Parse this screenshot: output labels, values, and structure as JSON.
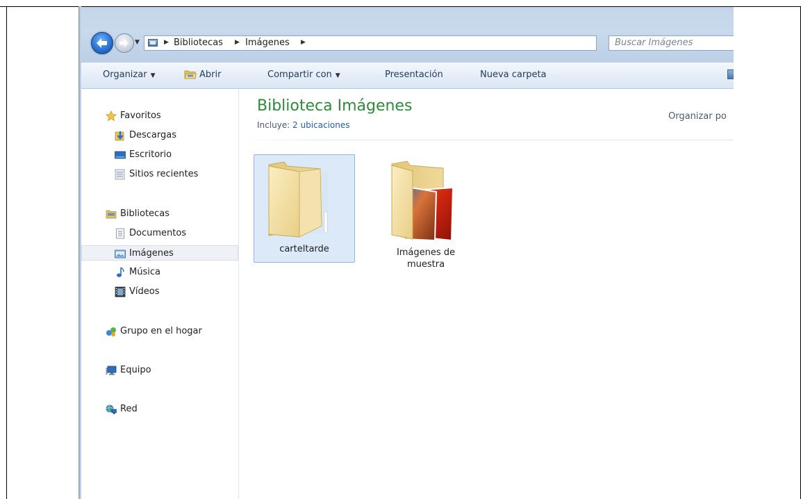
{
  "address_bar": {
    "crumbs": [
      "Bibliotecas",
      "Imágenes"
    ]
  },
  "search": {
    "placeholder": "Buscar Imágenes"
  },
  "toolbar": {
    "organize": "Organizar",
    "open": "Abrir",
    "share": "Compartir con",
    "slideshow": "Presentación",
    "new_folder": "Nueva carpeta"
  },
  "sidebar": {
    "favorites": {
      "label": "Favoritos",
      "items": [
        {
          "label": "Descargas",
          "icon": "downloads-icon"
        },
        {
          "label": "Escritorio",
          "icon": "desktop-icon"
        },
        {
          "label": "Sitios recientes",
          "icon": "recent-places-icon"
        }
      ]
    },
    "libraries": {
      "label": "Bibliotecas",
      "items": [
        {
          "label": "Documentos",
          "icon": "documents-icon"
        },
        {
          "label": "Imágenes",
          "icon": "pictures-icon",
          "selected": true
        },
        {
          "label": "Música",
          "icon": "music-icon"
        },
        {
          "label": "Vídeos",
          "icon": "videos-icon"
        }
      ]
    },
    "homegroup": "Grupo en el hogar",
    "computer": "Equipo",
    "network": "Red"
  },
  "content": {
    "title": "Biblioteca Imágenes",
    "includes_label": "Incluye:",
    "includes_link": "2 ubicaciones",
    "arrange_by": "Organizar po",
    "folders": [
      {
        "name": "carteltarde",
        "selected": true
      },
      {
        "name_line1": "Imágenes de",
        "name_line2": "muestra",
        "selected": false
      }
    ]
  },
  "colors": {
    "title_green": "#2e8b3a",
    "link_blue": "#1c5fb5",
    "selection_bg": "#dbe9f8"
  }
}
